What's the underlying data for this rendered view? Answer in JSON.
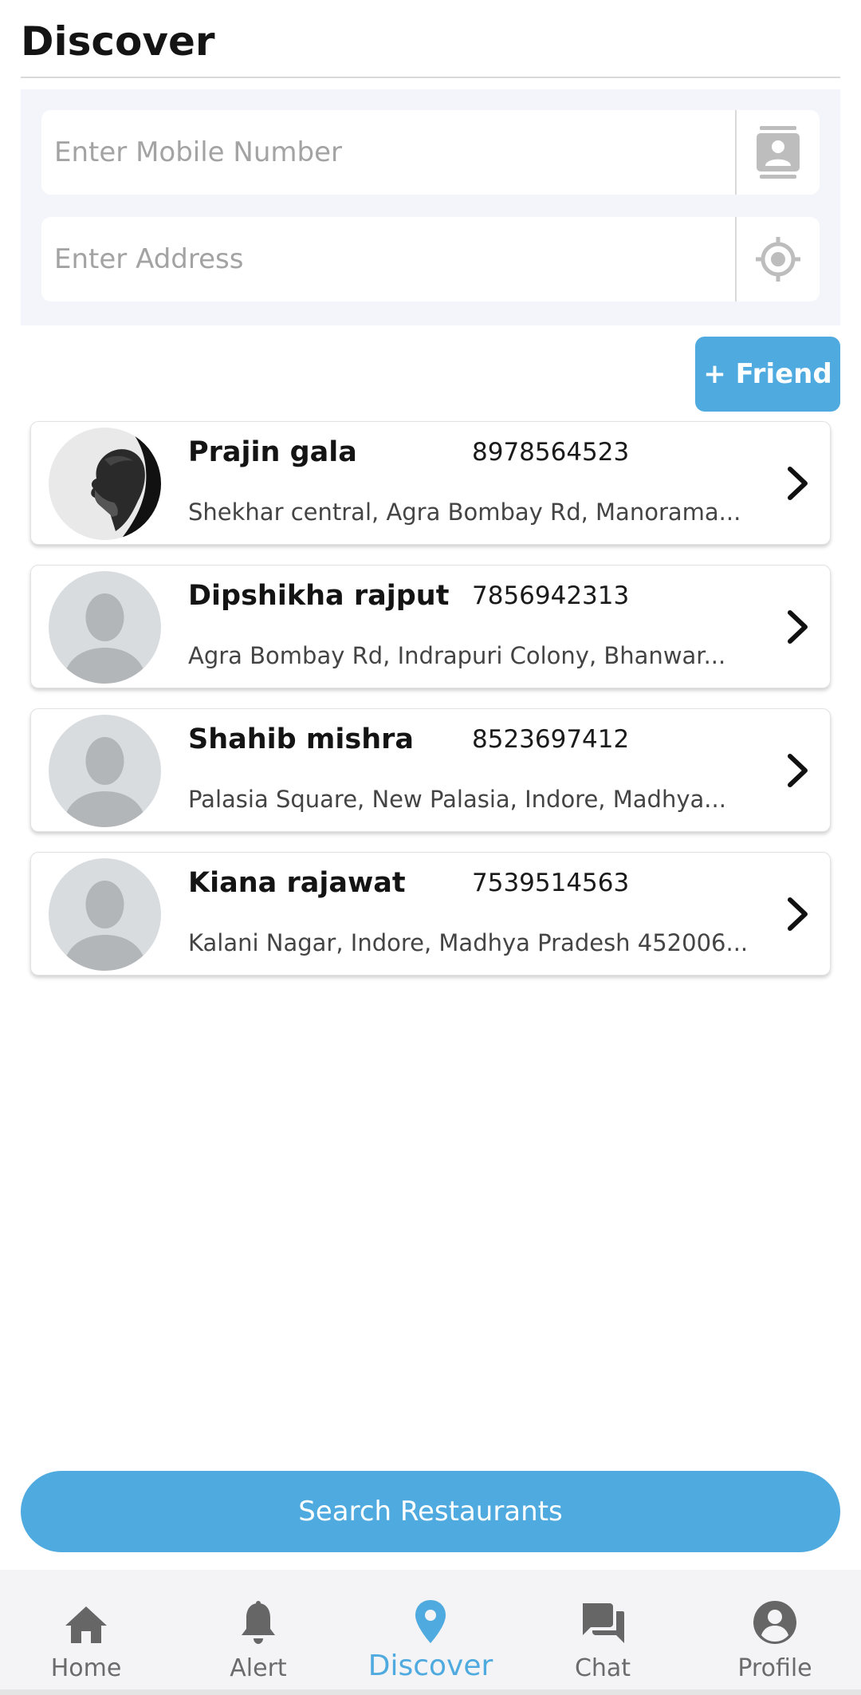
{
  "header": {
    "title": "Discover"
  },
  "search": {
    "mobile_placeholder": "Enter Mobile Number",
    "address_placeholder": "Enter Address",
    "mobile_icon": "contact-book-icon",
    "address_icon": "locate-target-icon"
  },
  "friend_button": {
    "label": "+ Friend"
  },
  "friends": [
    {
      "name": "Prajin gala",
      "phone": "8978564523",
      "address": "Shekhar central, Agra Bombay Rd, Manorama...",
      "avatar": "photo"
    },
    {
      "name": "Dipshikha rajput",
      "phone": "7856942313",
      "address": "Agra Bombay Rd, Indrapuri Colony, Bhanwar...",
      "avatar": "placeholder"
    },
    {
      "name": "Shahib mishra",
      "phone": "8523697412",
      "address": "Palasia Square, New Palasia, Indore, Madhya...",
      "avatar": "placeholder"
    },
    {
      "name": "Kiana rajawat",
      "phone": "7539514563",
      "address": "Kalani Nagar, Indore, Madhya Pradesh 452006...",
      "avatar": "placeholder"
    }
  ],
  "search_button": {
    "label": "Search Restaurants"
  },
  "tabs": [
    {
      "label": "Home",
      "icon": "home-icon",
      "active": false
    },
    {
      "label": "Alert",
      "icon": "bell-icon",
      "active": false
    },
    {
      "label": "Discover",
      "icon": "map-pin-icon",
      "active": true
    },
    {
      "label": "Chat",
      "icon": "chat-icon",
      "active": false
    },
    {
      "label": "Profile",
      "icon": "profile-icon",
      "active": false
    }
  ],
  "colors": {
    "accent": "#4faadf",
    "panel_bg": "#f4f5fa",
    "tabbar_bg": "#f4f4f6",
    "inactive_tab": "#6b6b6b"
  }
}
